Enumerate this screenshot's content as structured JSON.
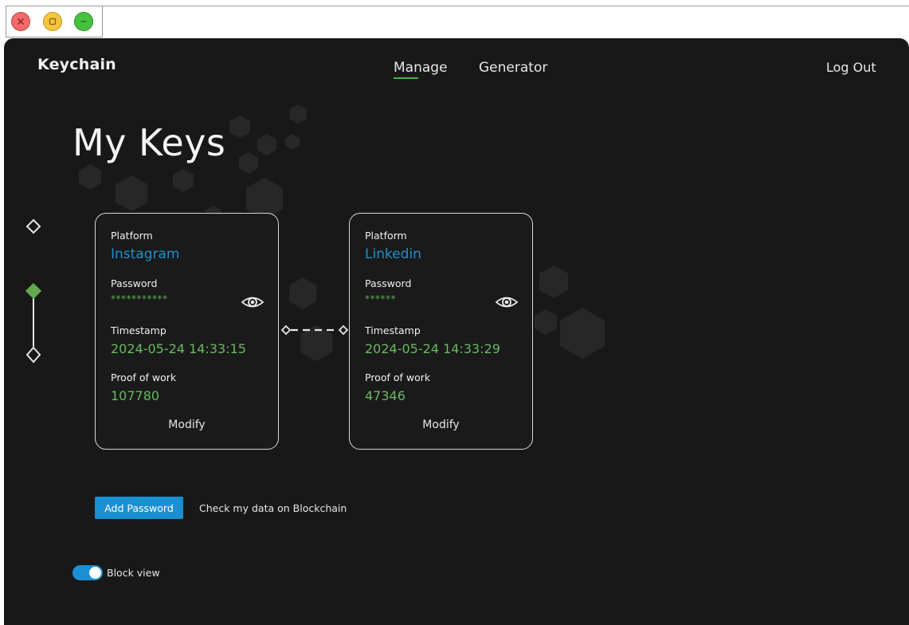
{
  "window": {
    "controls": [
      "close-icon",
      "maximize-icon",
      "minimize-icon"
    ]
  },
  "header": {
    "brand": "Keychain",
    "nav": [
      {
        "label": "Manage",
        "active": true
      },
      {
        "label": "Generator",
        "active": false
      }
    ],
    "logout_label": "Log Out"
  },
  "page": {
    "title": "My Keys"
  },
  "cards": [
    {
      "platform_label": "Platform",
      "platform": "Instagram",
      "password_label": "Password",
      "password_mask": "***********",
      "timestamp_label": "Timestamp",
      "timestamp": "2024-05-24 14:33:15",
      "pow_label": "Proof of work",
      "pow": "107780",
      "modify_label": "Modify"
    },
    {
      "platform_label": "Platform",
      "platform": "Linkedin",
      "password_label": "Password",
      "password_mask": "******",
      "timestamp_label": "Timestamp",
      "timestamp": "2024-05-24 14:33:29",
      "pow_label": "Proof of work",
      "pow": "47346",
      "modify_label": "Modify"
    }
  ],
  "actions": {
    "add_password_label": "Add Password",
    "check_blockchain_label": "Check my data on Blockchain"
  },
  "toggle": {
    "label": "Block view",
    "on": true
  },
  "colors": {
    "background": "#181818",
    "accent_blue": "#1a90d3",
    "accent_green": "#56b04e",
    "card_border": "#d6d6d6"
  },
  "icons": {
    "reveal": "eye-icon",
    "timeline_node": "diamond-icon",
    "chain_link": "chain-link-icon"
  }
}
